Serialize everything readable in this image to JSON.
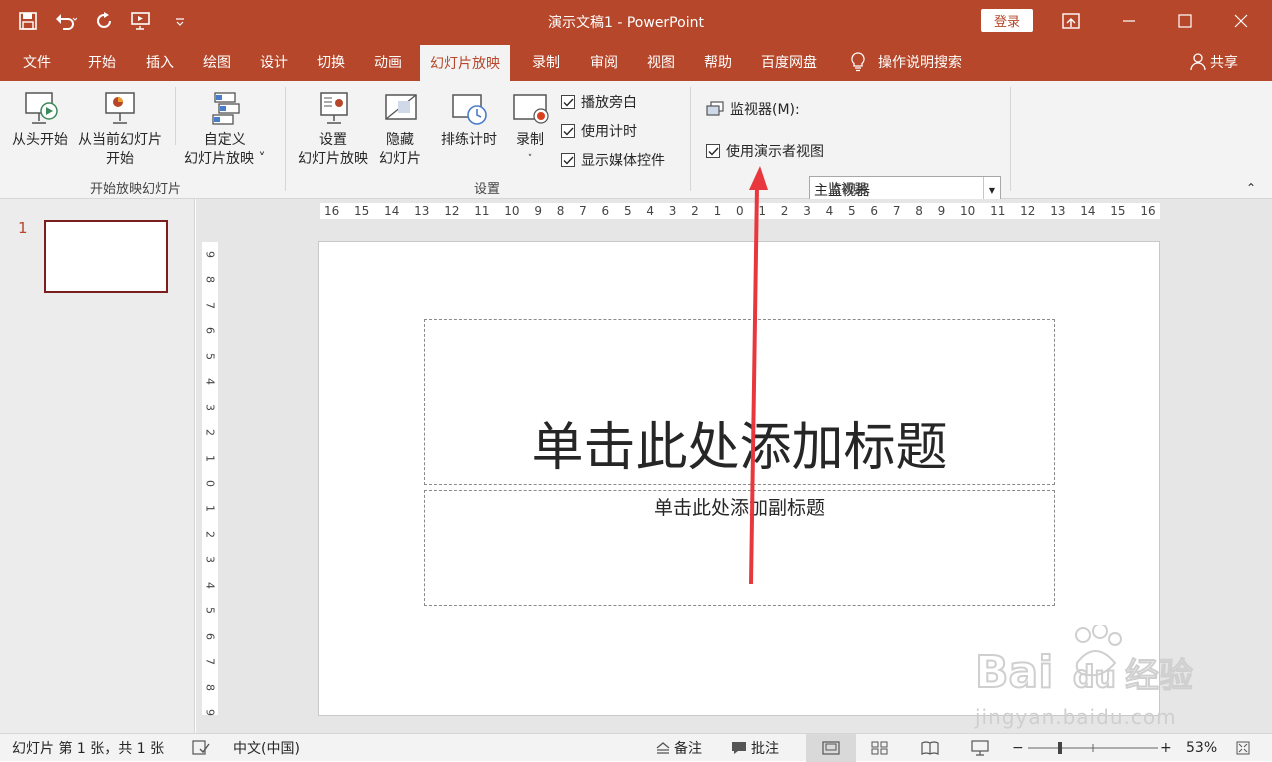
{
  "window": {
    "title": "演示文稿1 - PowerPoint",
    "login_label": "登录"
  },
  "tabs": [
    {
      "label": "文件"
    },
    {
      "label": "开始"
    },
    {
      "label": "插入"
    },
    {
      "label": "绘图"
    },
    {
      "label": "设计"
    },
    {
      "label": "切换"
    },
    {
      "label": "动画"
    },
    {
      "label": "幻灯片放映",
      "active": true
    },
    {
      "label": "录制"
    },
    {
      "label": "审阅"
    },
    {
      "label": "视图"
    },
    {
      "label": "帮助"
    },
    {
      "label": "百度网盘"
    },
    {
      "label": "操作说明搜索"
    }
  ],
  "share_label": "共享",
  "ribbon": {
    "start": {
      "from_beginning": "从头开始",
      "from_current_line1": "从当前幻灯片",
      "from_current_line2": "开始",
      "custom_line1": "自定义",
      "custom_line2": "幻灯片放映",
      "group_label": "开始放映幻灯片"
    },
    "setup": {
      "setup_line1": "设置",
      "setup_line2": "幻灯片放映",
      "hide_line1": "隐藏",
      "hide_line2": "幻灯片",
      "rehearse": "排练计时",
      "record": "录制",
      "checkboxes": [
        {
          "label": "播放旁白",
          "checked": true
        },
        {
          "label": "使用计时",
          "checked": true
        },
        {
          "label": "显示媒体控件",
          "checked": true
        }
      ],
      "group_label": "设置"
    },
    "monitors": {
      "monitor_label": "监视器(M):",
      "monitor_value": "主监视器",
      "presenter_view": {
        "label": "使用演示者视图",
        "checked": true
      },
      "group_label": "监视器"
    }
  },
  "thumbnails": [
    {
      "number": "1"
    }
  ],
  "ruler": {
    "horizontal": [
      "16",
      "15",
      "14",
      "13",
      "12",
      "11",
      "10",
      "9",
      "8",
      "7",
      "6",
      "5",
      "4",
      "3",
      "2",
      "1",
      "0",
      "1",
      "2",
      "3",
      "4",
      "5",
      "6",
      "7",
      "8",
      "9",
      "10",
      "11",
      "12",
      "13",
      "14",
      "15",
      "16"
    ],
    "vertical": [
      "9",
      "8",
      "7",
      "6",
      "5",
      "4",
      "3",
      "2",
      "1",
      "0",
      "1",
      "2",
      "3",
      "4",
      "5",
      "6",
      "7",
      "8",
      "9"
    ]
  },
  "slide": {
    "title_placeholder": "单击此处添加标题",
    "subtitle_placeholder": "单击此处添加副标题"
  },
  "status": {
    "slide_info": "幻灯片 第 1 张，共 1 张",
    "language": "中文(中国)",
    "notes": "备注",
    "comments": "批注",
    "zoom": "53%"
  },
  "watermark": {
    "brand": "Bai du 经验",
    "url": "jingyan.baidu.com"
  },
  "colors": {
    "accent": "#b7472a",
    "annotation_arrow": "#e8383d"
  }
}
